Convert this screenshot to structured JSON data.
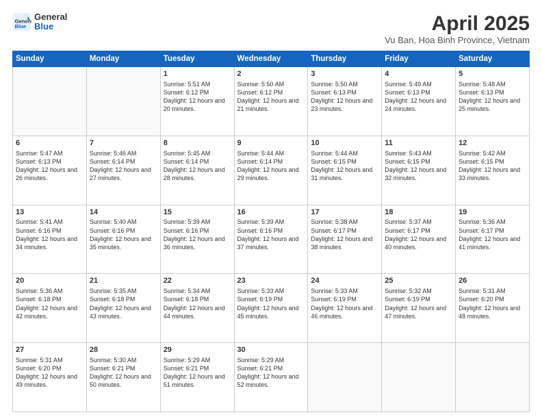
{
  "logo": {
    "general": "General",
    "blue": "Blue"
  },
  "title": "April 2025",
  "subtitle": "Vu Ban, Hoa Binh Province, Vietnam",
  "days_of_week": [
    "Sunday",
    "Monday",
    "Tuesday",
    "Wednesday",
    "Thursday",
    "Friday",
    "Saturday"
  ],
  "weeks": [
    [
      {
        "day": "",
        "info": ""
      },
      {
        "day": "",
        "info": ""
      },
      {
        "day": "1",
        "info": "Sunrise: 5:51 AM\nSunset: 6:12 PM\nDaylight: 12 hours and 20 minutes."
      },
      {
        "day": "2",
        "info": "Sunrise: 5:50 AM\nSunset: 6:12 PM\nDaylight: 12 hours and 21 minutes."
      },
      {
        "day": "3",
        "info": "Sunrise: 5:50 AM\nSunset: 6:13 PM\nDaylight: 12 hours and 23 minutes."
      },
      {
        "day": "4",
        "info": "Sunrise: 5:49 AM\nSunset: 6:13 PM\nDaylight: 12 hours and 24 minutes."
      },
      {
        "day": "5",
        "info": "Sunrise: 5:48 AM\nSunset: 6:13 PM\nDaylight: 12 hours and 25 minutes."
      }
    ],
    [
      {
        "day": "6",
        "info": "Sunrise: 5:47 AM\nSunset: 6:13 PM\nDaylight: 12 hours and 26 minutes."
      },
      {
        "day": "7",
        "info": "Sunrise: 5:46 AM\nSunset: 6:14 PM\nDaylight: 12 hours and 27 minutes."
      },
      {
        "day": "8",
        "info": "Sunrise: 5:45 AM\nSunset: 6:14 PM\nDaylight: 12 hours and 28 minutes."
      },
      {
        "day": "9",
        "info": "Sunrise: 5:44 AM\nSunset: 6:14 PM\nDaylight: 12 hours and 29 minutes."
      },
      {
        "day": "10",
        "info": "Sunrise: 5:44 AM\nSunset: 6:15 PM\nDaylight: 12 hours and 31 minutes."
      },
      {
        "day": "11",
        "info": "Sunrise: 5:43 AM\nSunset: 6:15 PM\nDaylight: 12 hours and 32 minutes."
      },
      {
        "day": "12",
        "info": "Sunrise: 5:42 AM\nSunset: 6:15 PM\nDaylight: 12 hours and 33 minutes."
      }
    ],
    [
      {
        "day": "13",
        "info": "Sunrise: 5:41 AM\nSunset: 6:16 PM\nDaylight: 12 hours and 34 minutes."
      },
      {
        "day": "14",
        "info": "Sunrise: 5:40 AM\nSunset: 6:16 PM\nDaylight: 12 hours and 35 minutes."
      },
      {
        "day": "15",
        "info": "Sunrise: 5:39 AM\nSunset: 6:16 PM\nDaylight: 12 hours and 36 minutes."
      },
      {
        "day": "16",
        "info": "Sunrise: 5:39 AM\nSunset: 6:16 PM\nDaylight: 12 hours and 37 minutes."
      },
      {
        "day": "17",
        "info": "Sunrise: 5:38 AM\nSunset: 6:17 PM\nDaylight: 12 hours and 38 minutes."
      },
      {
        "day": "18",
        "info": "Sunrise: 5:37 AM\nSunset: 6:17 PM\nDaylight: 12 hours and 40 minutes."
      },
      {
        "day": "19",
        "info": "Sunrise: 5:36 AM\nSunset: 6:17 PM\nDaylight: 12 hours and 41 minutes."
      }
    ],
    [
      {
        "day": "20",
        "info": "Sunrise: 5:36 AM\nSunset: 6:18 PM\nDaylight: 12 hours and 42 minutes."
      },
      {
        "day": "21",
        "info": "Sunrise: 5:35 AM\nSunset: 6:18 PM\nDaylight: 12 hours and 43 minutes."
      },
      {
        "day": "22",
        "info": "Sunrise: 5:34 AM\nSunset: 6:18 PM\nDaylight: 12 hours and 44 minutes."
      },
      {
        "day": "23",
        "info": "Sunrise: 5:33 AM\nSunset: 6:19 PM\nDaylight: 12 hours and 45 minutes."
      },
      {
        "day": "24",
        "info": "Sunrise: 5:33 AM\nSunset: 6:19 PM\nDaylight: 12 hours and 46 minutes."
      },
      {
        "day": "25",
        "info": "Sunrise: 5:32 AM\nSunset: 6:19 PM\nDaylight: 12 hours and 47 minutes."
      },
      {
        "day": "26",
        "info": "Sunrise: 5:31 AM\nSunset: 6:20 PM\nDaylight: 12 hours and 48 minutes."
      }
    ],
    [
      {
        "day": "27",
        "info": "Sunrise: 5:31 AM\nSunset: 6:20 PM\nDaylight: 12 hours and 49 minutes."
      },
      {
        "day": "28",
        "info": "Sunrise: 5:30 AM\nSunset: 6:21 PM\nDaylight: 12 hours and 50 minutes."
      },
      {
        "day": "29",
        "info": "Sunrise: 5:29 AM\nSunset: 6:21 PM\nDaylight: 12 hours and 51 minutes."
      },
      {
        "day": "30",
        "info": "Sunrise: 5:29 AM\nSunset: 6:21 PM\nDaylight: 12 hours and 52 minutes."
      },
      {
        "day": "",
        "info": ""
      },
      {
        "day": "",
        "info": ""
      },
      {
        "day": "",
        "info": ""
      }
    ]
  ]
}
